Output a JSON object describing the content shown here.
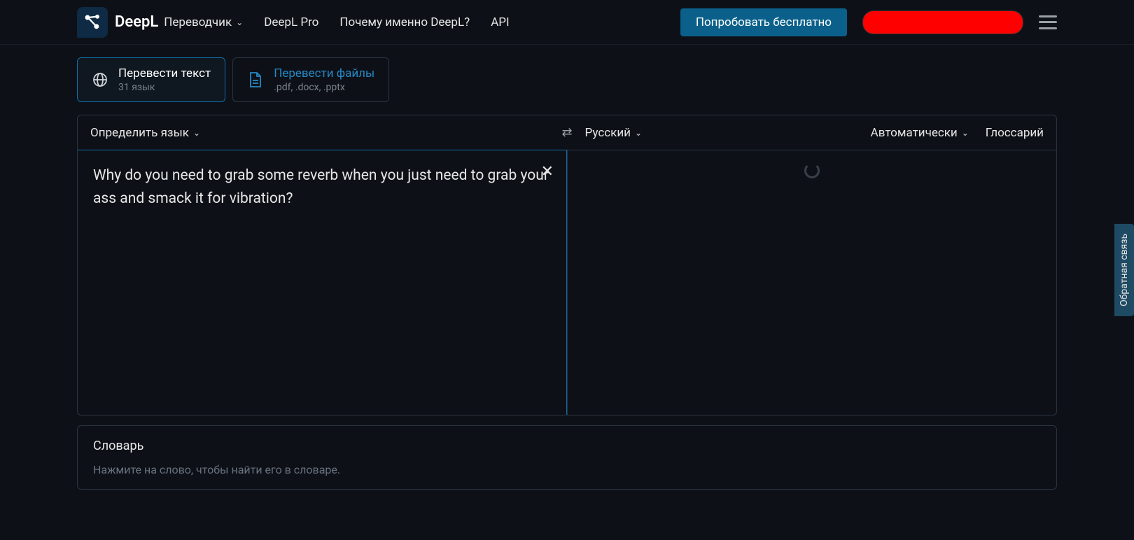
{
  "header": {
    "brand": "DeepL",
    "nav": {
      "translator": "Переводчик",
      "pro": "DeepL Pro",
      "why": "Почему именно DeepL?",
      "api": "API"
    },
    "cta": "Попробовать бесплатно"
  },
  "modes": {
    "text": {
      "title": "Перевести текст",
      "sub": "31 язык"
    },
    "files": {
      "title": "Перевести файлы",
      "sub": ".pdf, .docx, .pptx"
    }
  },
  "langbar": {
    "source": "Определить язык",
    "target": "Русский",
    "auto": "Автоматически",
    "glossary": "Глоссарий"
  },
  "source_text": "Why do you need to grab some reverb when you just need to grab your ass and smack it for vibration?",
  "dictionary": {
    "title": "Словарь",
    "hint": "Нажмите на слово, чтобы найти его в словаре."
  },
  "feedback": "Обратная связь"
}
